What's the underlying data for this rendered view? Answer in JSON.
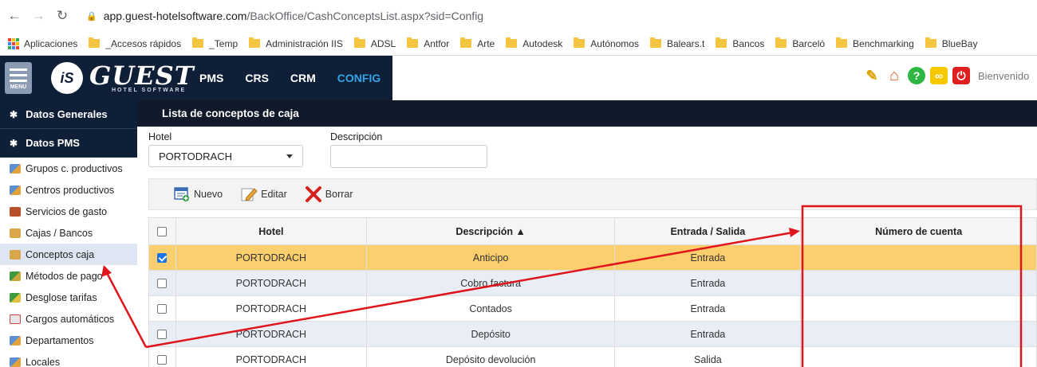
{
  "browser": {
    "url_host": "app.guest-hotelsoftware.com",
    "url_path": "/BackOffice/CashConceptsList.aspx?sid=Config",
    "bookmarks": [
      "Aplicaciones",
      "_Accesos rápidos",
      "_Temp",
      "Administración IIS",
      "ADSL",
      "Antfor",
      "Arte",
      "Autodesk",
      "Autónomos",
      "Balears.t",
      "Bancos",
      "Barceló",
      "Benchmarking",
      "BlueBay"
    ]
  },
  "header": {
    "menu_label": "MENU",
    "logo_mark": "iS",
    "logo_text": "GUEST",
    "logo_sub": "HOTEL SOFTWARE",
    "nav": [
      "PMS",
      "CRS",
      "CRM",
      "CONFIG"
    ],
    "active_nav": "CONFIG",
    "welcome": "Bienvenido"
  },
  "sidebar": {
    "sections": [
      "Datos Generales",
      "Datos PMS"
    ],
    "items": [
      {
        "label": "Grupos c. productivos",
        "icon": "group-icon"
      },
      {
        "label": "Centros productivos",
        "icon": "group-icon"
      },
      {
        "label": "Servicios de gasto",
        "icon": "service-icon"
      },
      {
        "label": "Cajas / Bancos",
        "icon": "cashbox-icon"
      },
      {
        "label": "Conceptos caja",
        "icon": "cashbox-icon",
        "active": true
      },
      {
        "label": "Métodos de pago",
        "icon": "payment-icon"
      },
      {
        "label": "Desglose tarifas",
        "icon": "money-icon"
      },
      {
        "label": "Cargos automáticos",
        "icon": "calendar-icon"
      },
      {
        "label": "Departamentos",
        "icon": "department-icon"
      },
      {
        "label": "Locales",
        "icon": "department-icon"
      }
    ]
  },
  "main": {
    "title": "Lista de conceptos de caja",
    "filters": {
      "hotel_label": "Hotel",
      "hotel_value": "PORTODRACH",
      "description_label": "Descripción",
      "description_value": ""
    },
    "toolbar": {
      "new": "Nuevo",
      "edit": "Editar",
      "delete": "Borrar"
    },
    "table": {
      "columns": [
        "Hotel",
        "Descripción ▲",
        "Entrada / Salida",
        "Número de cuenta"
      ],
      "rows": [
        {
          "hotel": "PORTODRACH",
          "desc": "Anticipo",
          "io": "Entrada",
          "account": "",
          "checked": true
        },
        {
          "hotel": "PORTODRACH",
          "desc": "Cobro factura",
          "io": "Entrada",
          "account": "",
          "checked": false
        },
        {
          "hotel": "PORTODRACH",
          "desc": "Contados",
          "io": "Entrada",
          "account": "",
          "checked": false
        },
        {
          "hotel": "PORTODRACH",
          "desc": "Depósito",
          "io": "Entrada",
          "account": "",
          "checked": false
        },
        {
          "hotel": "PORTODRACH",
          "desc": "Depósito devolución",
          "io": "Salida",
          "account": "",
          "checked": false
        }
      ]
    }
  },
  "colors": {
    "header_bg": "#0f1f38",
    "accent": "#2fa4e7",
    "selected_row": "#fbce6e",
    "annotation_red": "#e0141b"
  }
}
